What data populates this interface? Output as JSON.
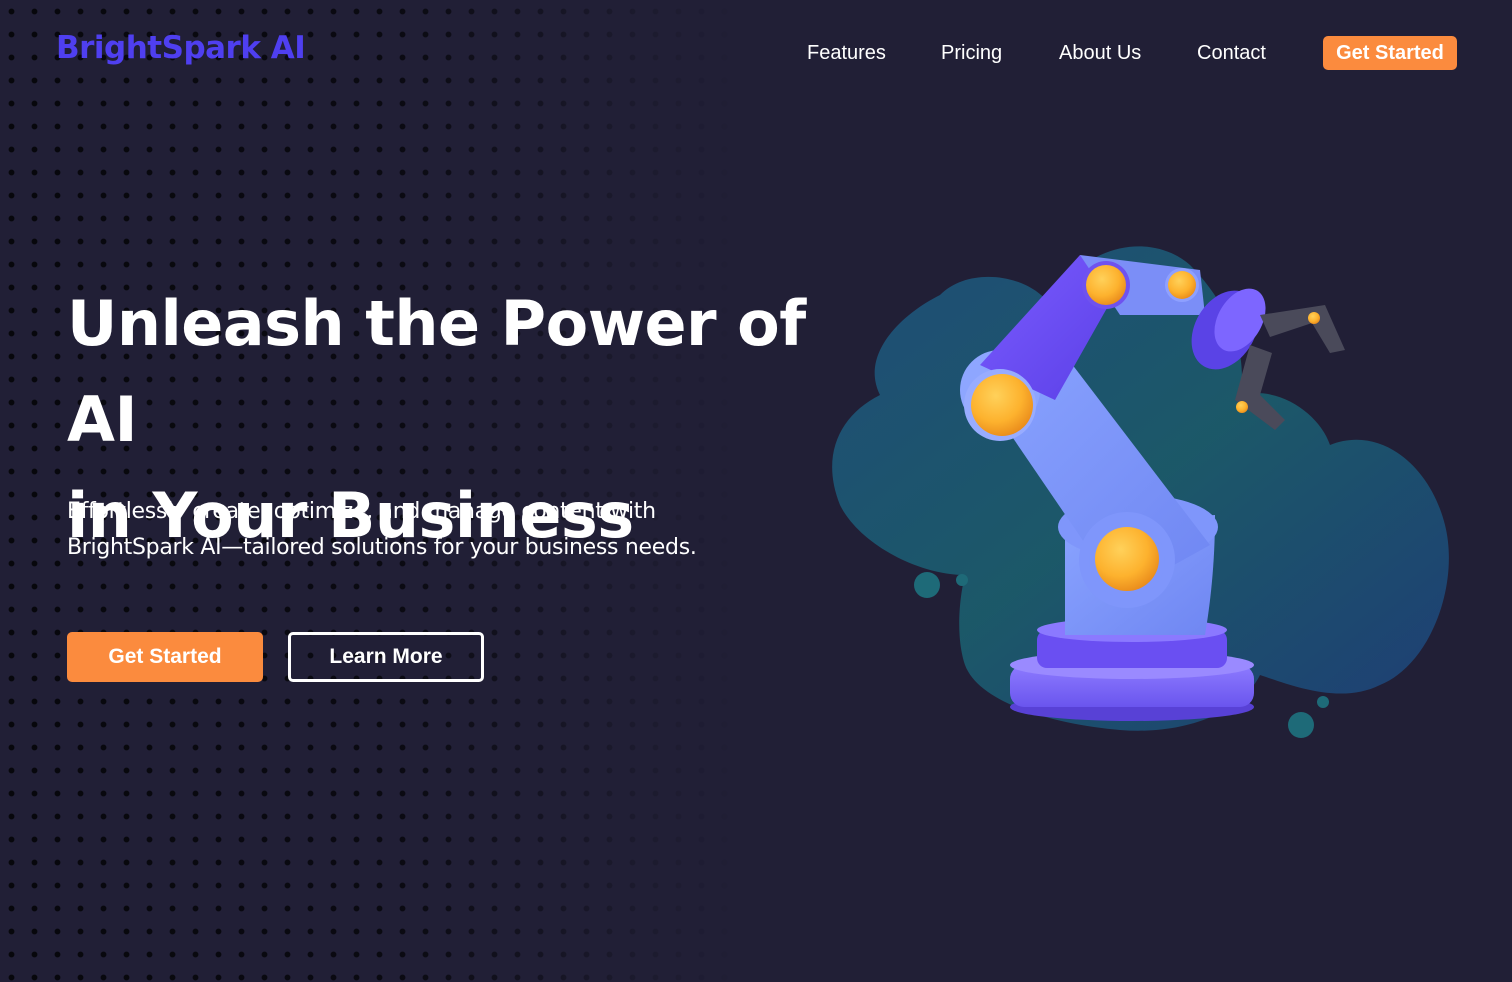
{
  "brand": {
    "name": "BrightSpark AI",
    "color": "#4f3ff0"
  },
  "nav": {
    "items": [
      {
        "label": "Features"
      },
      {
        "label": "Pricing"
      },
      {
        "label": "About Us"
      },
      {
        "label": "Contact"
      }
    ],
    "cta_label": "Get Started"
  },
  "hero": {
    "title_line1": "Unleash the Power of AI",
    "title_line2": "in Your Business",
    "subtitle_line1": "Effortlessly create, optimize, and manage content with",
    "subtitle_line2": "BrightSpark AI—tailored solutions for your business needs.",
    "primary_button": "Get Started",
    "secondary_button": "Learn More",
    "illustration": "robotic-arm-illustration"
  },
  "colors": {
    "background": "#211f36",
    "accent": "#fb8b3e",
    "text": "#ffffff",
    "robot_purple": "#6a4ff2",
    "robot_joint": "#fdb22e",
    "blob_teal": "#1d5a6c"
  }
}
